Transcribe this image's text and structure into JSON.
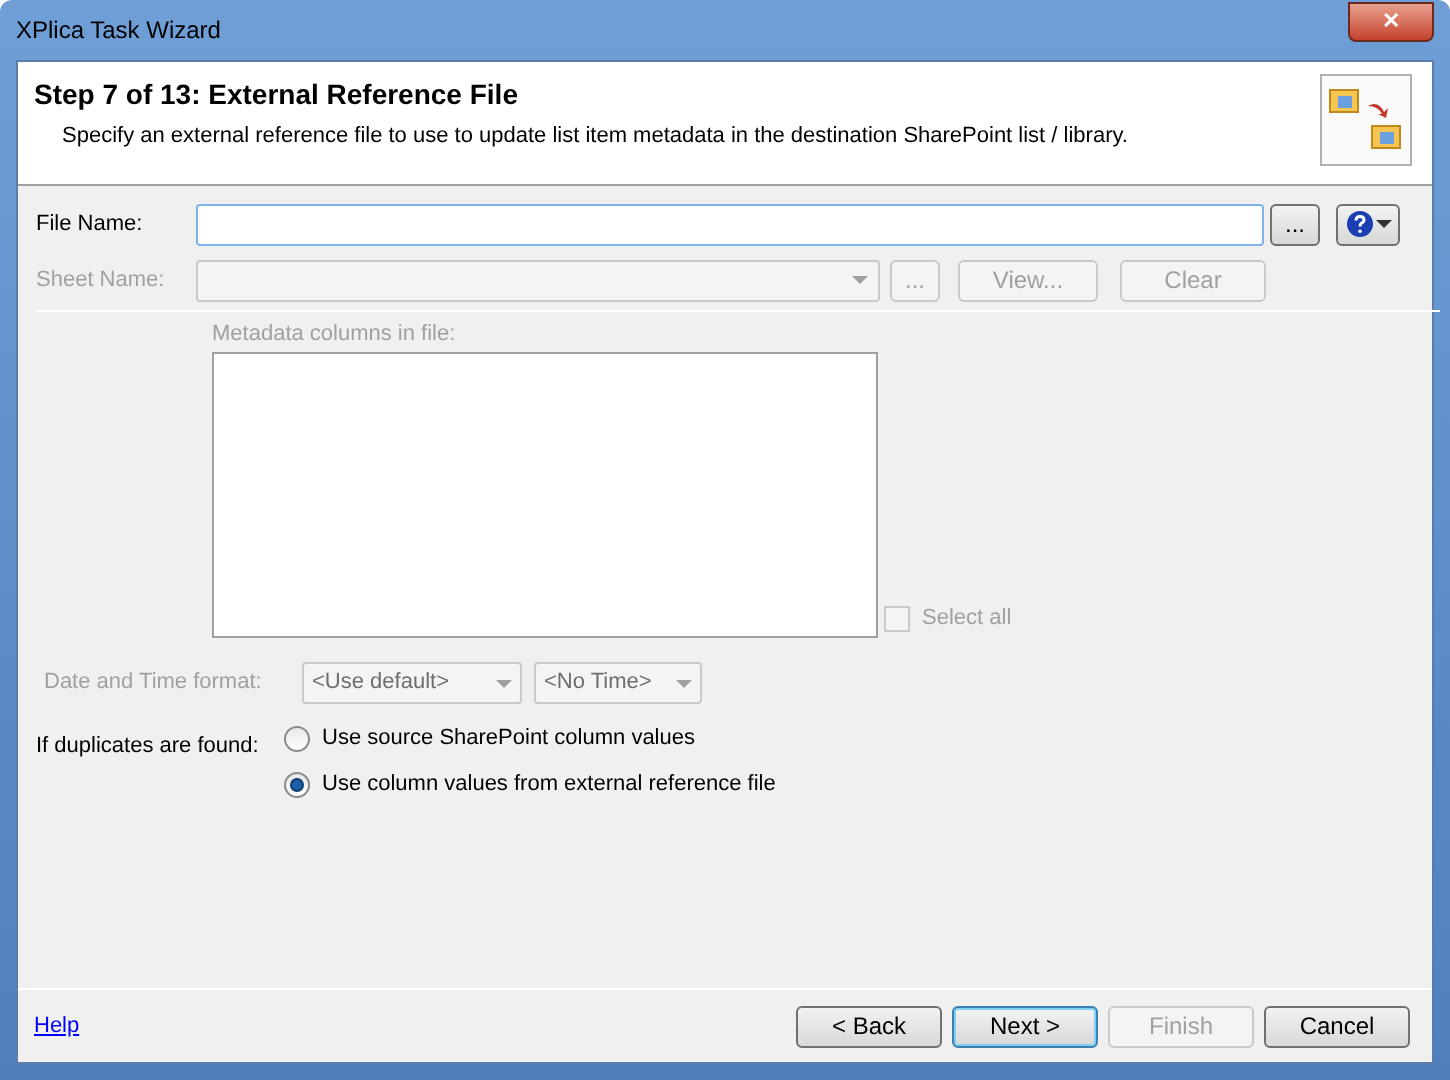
{
  "window": {
    "title": "XPlica Task Wizard",
    "close": "✕"
  },
  "header": {
    "title": "Step 7 of 13: External Reference File",
    "description": "Specify an external reference file to use to update list item metadata in the destination SharePoint list / library."
  },
  "file_name": {
    "label": "File Name:",
    "browse": "..."
  },
  "sheet_name": {
    "label": "Sheet Name:",
    "browse": "...",
    "view": "View...",
    "clear": "Clear",
    "disabled": true
  },
  "metadata": {
    "label": "Metadata columns in file:",
    "disabled": true
  },
  "select_all": {
    "label": "Select all",
    "checked": false,
    "disabled": true
  },
  "date_time": {
    "label": "Date and Time format:",
    "format": "<Use default>",
    "time": "<No Time>",
    "disabled": true
  },
  "duplicates": {
    "label": "If duplicates are found:",
    "options": [
      {
        "label": "Use source SharePoint column values",
        "selected": false
      },
      {
        "label": "Use column values from external reference file",
        "selected": true
      }
    ]
  },
  "footer": {
    "help": "Help",
    "buttons": [
      {
        "label": "< Back",
        "disabled": false,
        "default": false
      },
      {
        "label": "Next >",
        "disabled": false,
        "default": true
      },
      {
        "label": "Finish",
        "disabled": true,
        "default": false
      },
      {
        "label": "Cancel",
        "disabled": false,
        "default": false
      }
    ]
  }
}
